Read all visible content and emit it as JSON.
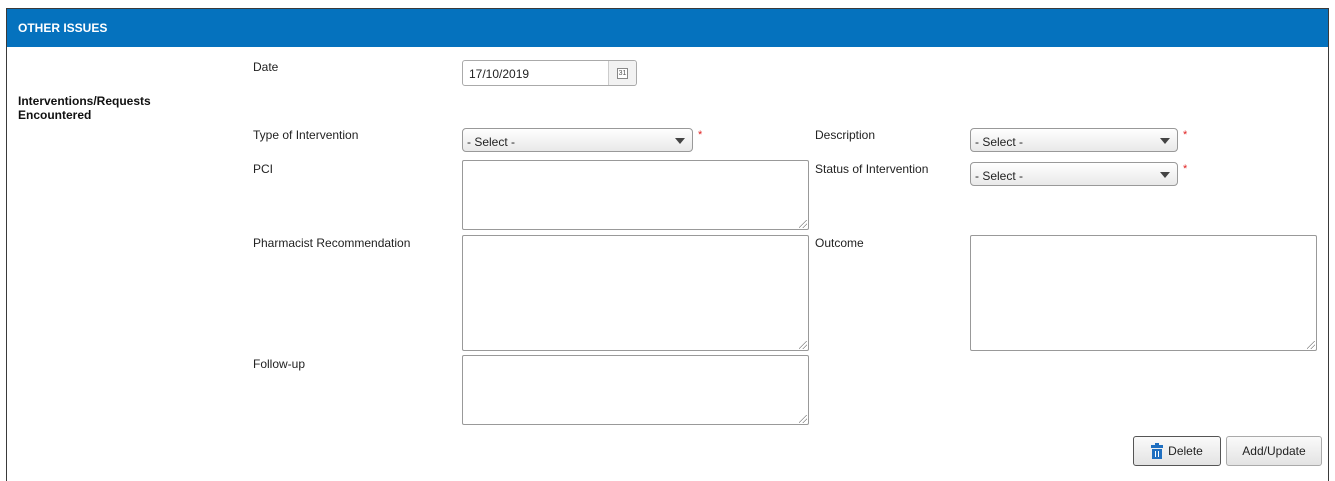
{
  "section": {
    "title": "OTHER ISSUES",
    "subtitle": "Interventions/Requests Encountered"
  },
  "fields": {
    "date": {
      "label": "Date",
      "value": "17/10/2019"
    },
    "type_of_intervention": {
      "label": "Type of Intervention",
      "value": "- Select -",
      "required": "*"
    },
    "description": {
      "label": "Description",
      "value": "- Select -",
      "required": "*"
    },
    "pci": {
      "label": "PCI",
      "value": ""
    },
    "status_of_intervention": {
      "label": "Status of Intervention",
      "value": "- Select -",
      "required": "*"
    },
    "pharmacist_recommendation": {
      "label": "Pharmacist Recommendation",
      "value": ""
    },
    "outcome": {
      "label": "Outcome",
      "value": ""
    },
    "follow_up": {
      "label": "Follow-up",
      "value": ""
    }
  },
  "buttons": {
    "delete": "Delete",
    "add_update": "Add/Update"
  },
  "colors": {
    "header": "#0572be",
    "required": "#e02020",
    "delete_icon": "#1f6fc0"
  },
  "icons": {
    "calendar": "calendar-icon",
    "dropdown": "chevron-down-icon",
    "delete": "trash-icon"
  }
}
